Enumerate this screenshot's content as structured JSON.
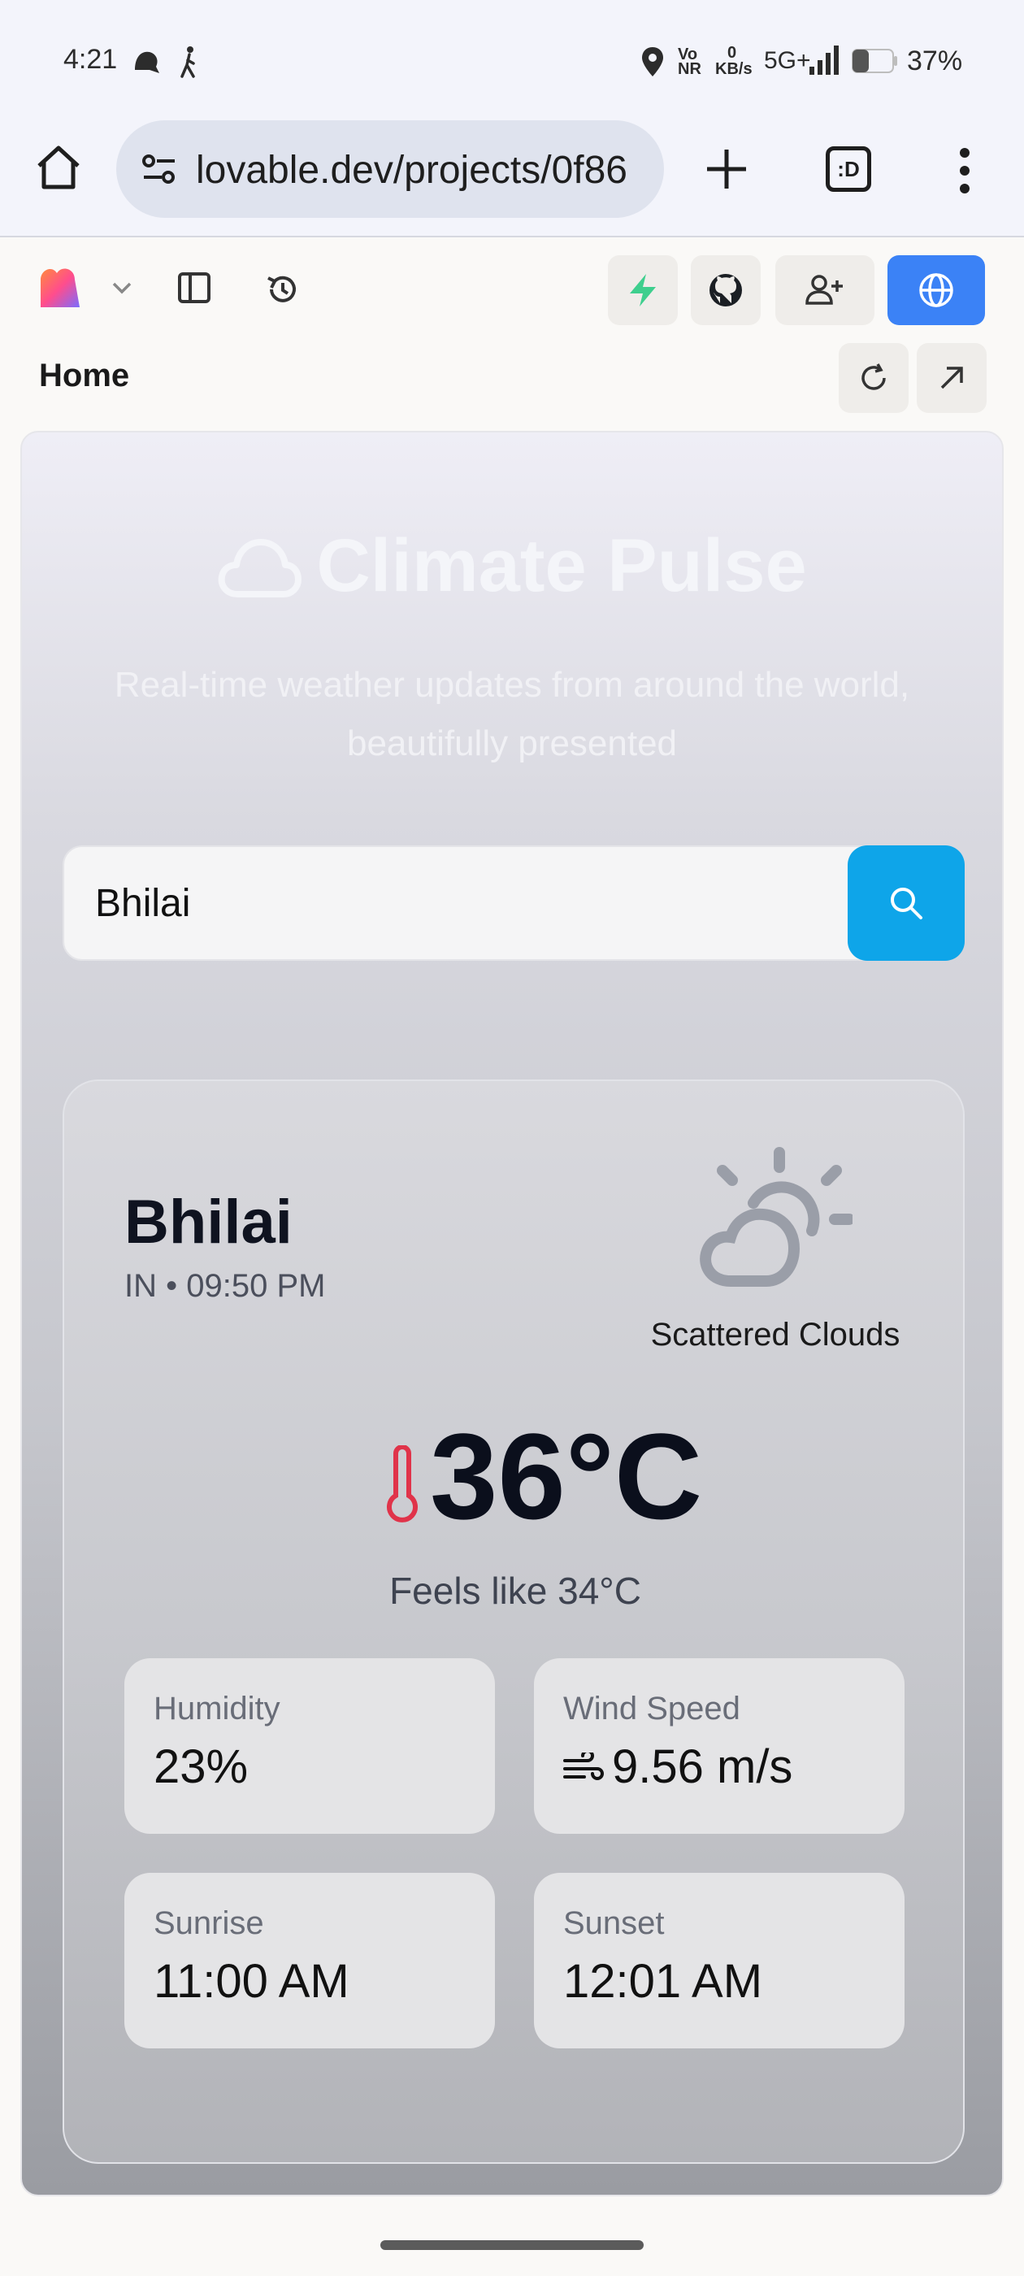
{
  "status_bar": {
    "time": "4:21",
    "network_vo": "Vo",
    "network_nr": "NR",
    "data_rate_value": "0",
    "data_rate_unit": "KB/s",
    "network_type": "5G+",
    "battery_percent": "37%"
  },
  "browser": {
    "url": "lovable.dev/projects/0f86",
    "tab_button_label": ":D"
  },
  "app": {
    "breadcrumb": "Home"
  },
  "weather_app": {
    "title": "Climate Pulse",
    "subtitle": "Real-time weather updates from around the world, beautifully presented",
    "search_value": "Bhilai",
    "card": {
      "city": "Bhilai",
      "meta": "IN • 09:50 PM",
      "condition": "Scattered Clouds",
      "temperature": "36°C",
      "feels_like": "Feels like 34°C",
      "stats": {
        "humidity_label": "Humidity",
        "humidity_value": "23%",
        "wind_label": "Wind Speed",
        "wind_value": "9.56 m/s",
        "sunrise_label": "Sunrise",
        "sunrise_value": "11:00 AM",
        "sunset_label": "Sunset",
        "sunset_value": "12:01 AM"
      }
    }
  },
  "colors": {
    "accent": "#0ea5e9",
    "publish_button": "#3b82f6",
    "thermometer": "#e0334a"
  }
}
